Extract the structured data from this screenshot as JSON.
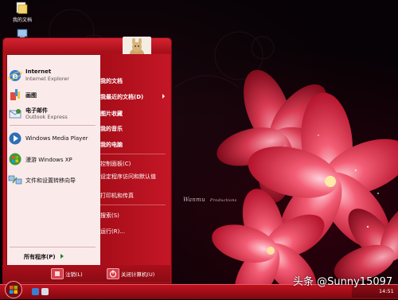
{
  "desktop": {
    "icons": [
      {
        "label": "我的文档",
        "icon": "folder-documents-icon"
      },
      {
        "label": "",
        "icon": "my-computer-icon"
      }
    ],
    "wallpaper_text": "Wanmu",
    "wallpaper_text_small": "Productions"
  },
  "start_menu": {
    "pinned": [
      {
        "title": "Internet",
        "subtitle": "Internet Explorer",
        "icon": "internet-explorer-icon"
      },
      {
        "title": "画图",
        "subtitle": "",
        "icon": "paint-icon"
      },
      {
        "title": "电子邮件",
        "subtitle": "Outlook Express",
        "icon": "outlook-express-icon"
      }
    ],
    "recent": [
      {
        "label": "Windows Media Player",
        "icon": "media-player-icon"
      },
      {
        "label": "漫游 Windows XP",
        "icon": "tour-xp-icon"
      },
      {
        "label": "文件和设置转移向导",
        "icon": "transfer-wizard-icon"
      }
    ],
    "all_programs": "所有程序(P)",
    "right_items": [
      {
        "label": "我的文档",
        "bold": true
      },
      {
        "label": "我最近的文档(D)",
        "bold": true,
        "submenu": true
      },
      {
        "label": "图片收藏",
        "bold": true
      },
      {
        "label": "我的音乐",
        "bold": true
      },
      {
        "label": "我的电脑",
        "bold": true
      },
      {
        "label": "控制面板(C)",
        "bold": false
      },
      {
        "label": "设定程序访问和默认值",
        "bold": false
      },
      {
        "label": "打印机和传真",
        "bold": false
      },
      {
        "label": "搜索(S)",
        "bold": false
      },
      {
        "label": "运行(R)...",
        "bold": false
      }
    ],
    "logoff": "注销(L)",
    "shutdown": "关闭计算机(U)"
  },
  "taskbar": {
    "clock": "14:51"
  },
  "watermark": "头条 @Sunny15097",
  "colors": {
    "menu_red": "#b3101b",
    "left_pane": "#fbeaea",
    "taskbar_red": "#c2121f",
    "flower_pink": "#f05a6e"
  }
}
